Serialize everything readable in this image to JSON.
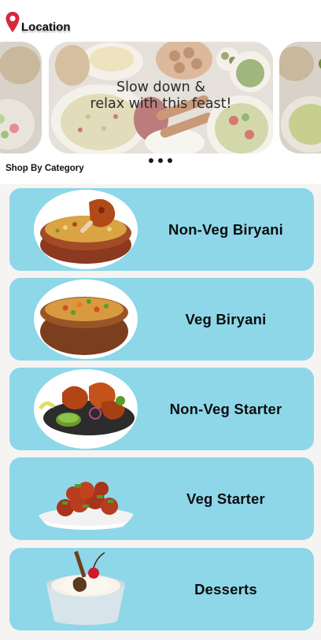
{
  "header": {
    "location_label": "Location",
    "location_icon": "map-pin-icon"
  },
  "banner": {
    "line1": "Slow down &",
    "line2": "relax with this feast!"
  },
  "carousel": {
    "dot_count": 3
  },
  "section": {
    "title": "Shop By Category"
  },
  "categories": [
    {
      "label": "Non-Veg Biryani",
      "image": "non-veg-biryani-image"
    },
    {
      "label": "Veg Biryani",
      "image": "veg-biryani-image"
    },
    {
      "label": "Non-Veg Starter",
      "image": "non-veg-starter-image"
    },
    {
      "label": "Veg Starter",
      "image": "veg-starter-image"
    },
    {
      "label": "Desserts",
      "image": "desserts-image"
    }
  ],
  "colors": {
    "card_bg": "#8ed7e9",
    "pin_red": "#d7263d",
    "list_bg": "#f5f4f2"
  }
}
